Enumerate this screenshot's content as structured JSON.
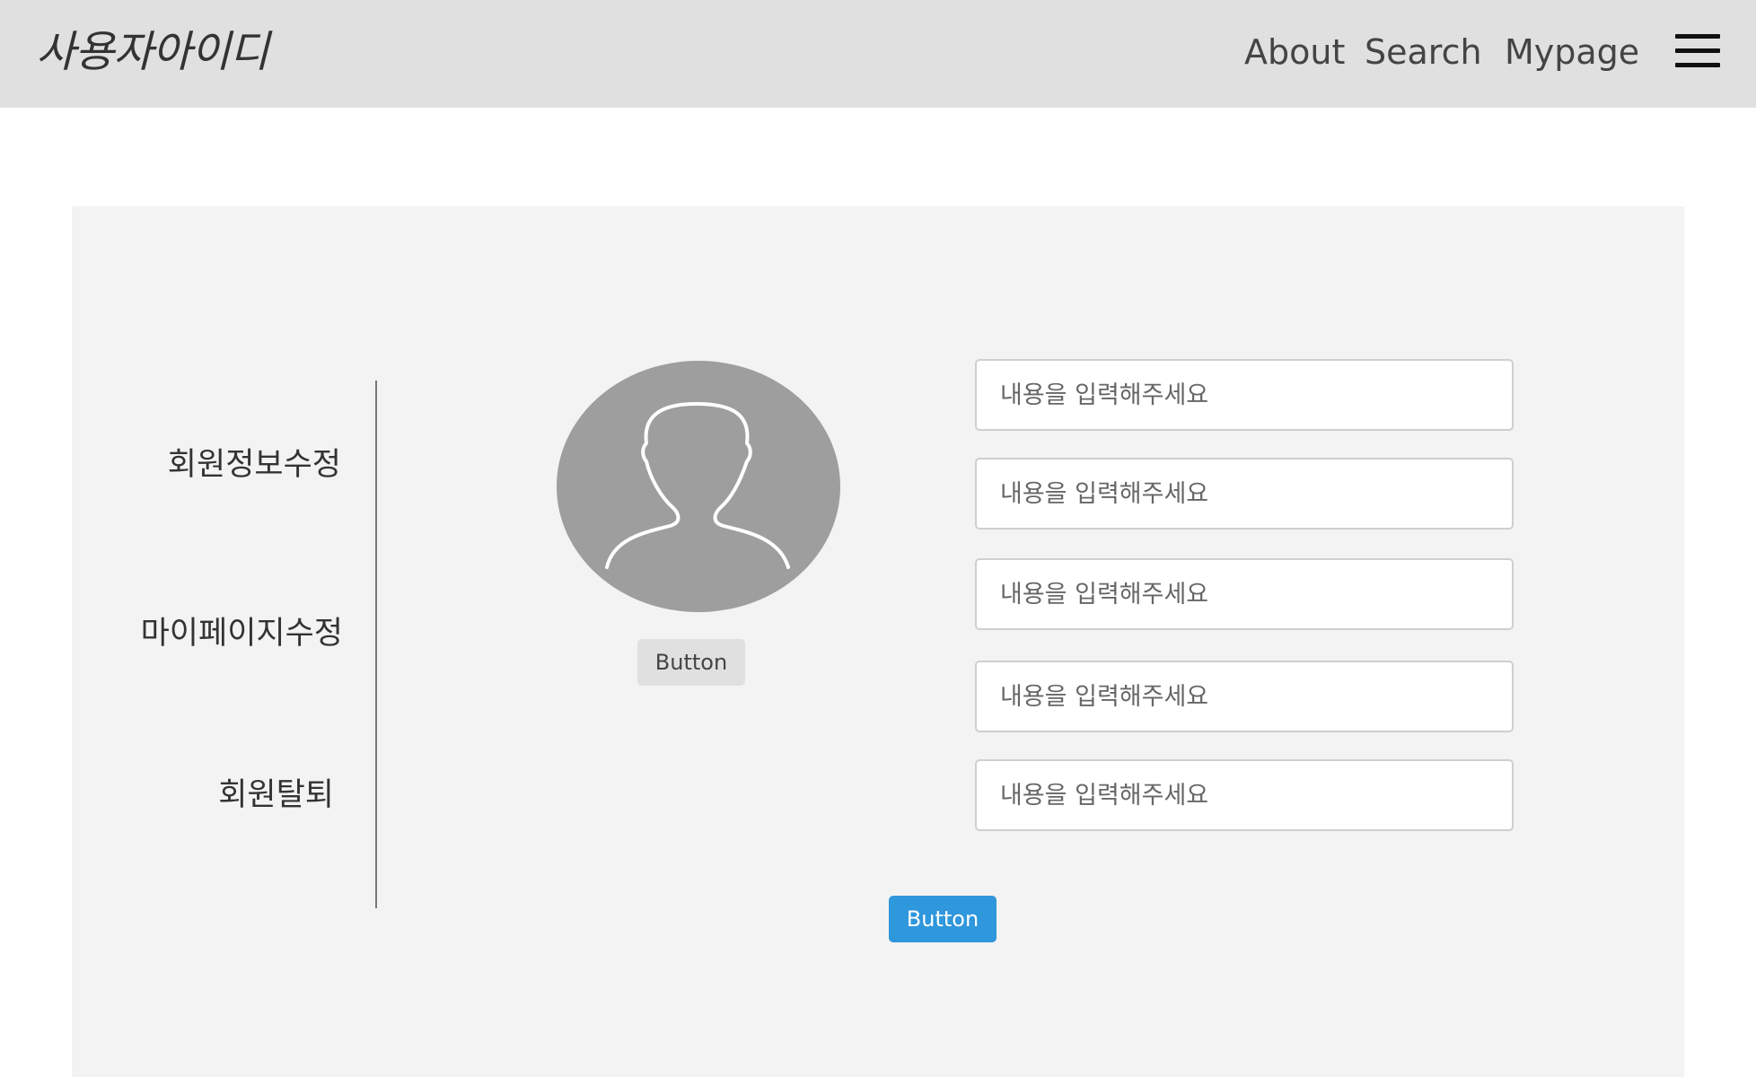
{
  "header": {
    "brand": "사용자아이디",
    "nav": [
      {
        "label": "About"
      },
      {
        "label": "Search"
      },
      {
        "label": "Mypage"
      }
    ],
    "menu_icon": "hamburger-menu-icon"
  },
  "sidebar": {
    "items": [
      {
        "label": "회원정보수정"
      },
      {
        "label": "마이페이지수정"
      },
      {
        "label": "회원탈퇴"
      }
    ]
  },
  "profile": {
    "avatar_icon": "user-silhouette-icon",
    "avatar_color": "#9e9e9e",
    "upload_button_label": "Button"
  },
  "form": {
    "fields": [
      {
        "placeholder": "내용을 입력해주세요",
        "value": ""
      },
      {
        "placeholder": "내용을 입력해주세요",
        "value": ""
      },
      {
        "placeholder": "내용을 입력해주세요",
        "value": ""
      },
      {
        "placeholder": "내용을 입력해주세요",
        "value": ""
      },
      {
        "placeholder": "내용을 입력해주세요",
        "value": ""
      }
    ],
    "submit_label": "Button",
    "submit_color": "#2f97dc"
  }
}
